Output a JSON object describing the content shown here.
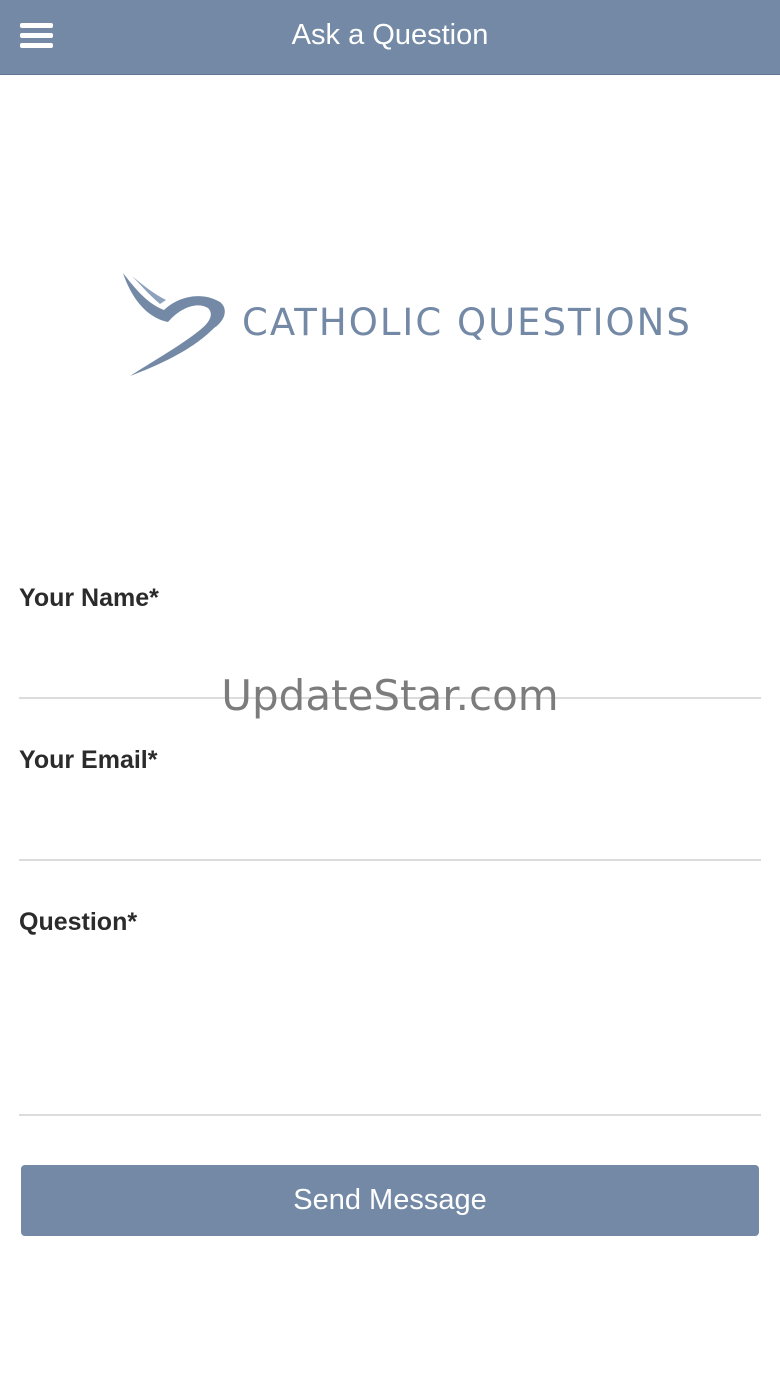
{
  "header": {
    "title": "Ask a Question",
    "menu_icon": "hamburger-icon"
  },
  "logo": {
    "icon": "dove-icon",
    "text": "CATHOLIC QUESTIONS"
  },
  "form": {
    "name_label": "Your Name*",
    "name_value": "",
    "email_label": "Your Email*",
    "email_value": "",
    "question_label": "Question*",
    "question_value": "",
    "submit_label": "Send Message"
  },
  "watermark": "UpdateStar.com",
  "colors": {
    "brand": "#7389a6",
    "background": "#ffffff",
    "label": "#2b2b2b",
    "divider": "#dcdcdc"
  }
}
